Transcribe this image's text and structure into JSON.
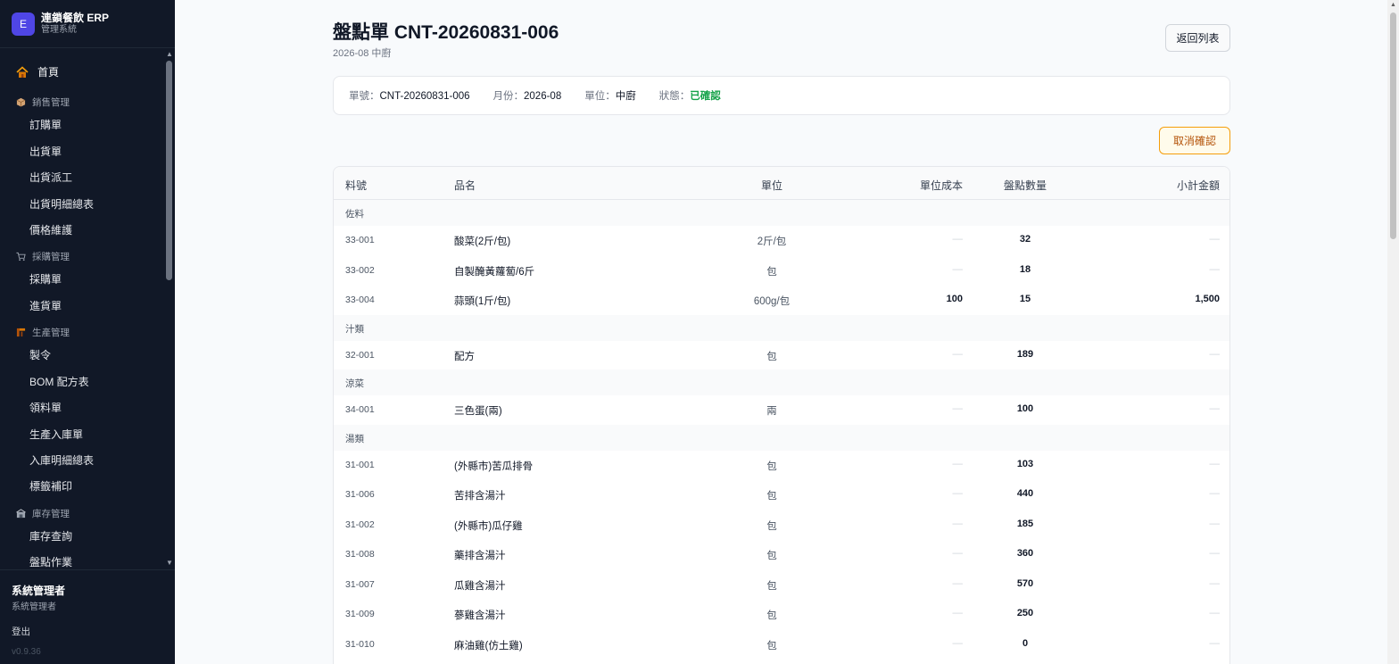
{
  "app": {
    "logo_letter": "E",
    "title": "連鎖餐飲 ERP",
    "subtitle": "管理系統"
  },
  "sidebar": {
    "home": "首頁",
    "sections": [
      {
        "label": "銷售管理",
        "icon": "box-icon",
        "items": [
          "訂購單",
          "出貨單",
          "出貨派工",
          "出貨明細總表",
          "價格維護"
        ]
      },
      {
        "label": "採購管理",
        "icon": "cart-icon",
        "items": [
          "採購單",
          "進貨單"
        ]
      },
      {
        "label": "生產管理",
        "icon": "tools-icon",
        "items": [
          "製令",
          "BOM 配方表",
          "領料單",
          "生產入庫單",
          "入庫明細總表",
          "標籤補印"
        ]
      },
      {
        "label": "庫存管理",
        "icon": "warehouse-icon",
        "items": [
          "庫存查詢",
          "盤點作業"
        ]
      }
    ]
  },
  "user": {
    "name": "系統管理者",
    "role": "系統管理者",
    "logout": "登出",
    "version": "v0.9.36"
  },
  "page": {
    "title": "盤點單 CNT-20260831-006",
    "subtitle": "2026-08 中廚",
    "back_button": "返回列表",
    "cancel_button": "取消確認"
  },
  "info": {
    "doc_no_label": "單號：",
    "doc_no": "CNT-20260831-006",
    "month_label": "月份：",
    "month": "2026-08",
    "unit_label": "單位：",
    "unit": "中廚",
    "status_label": "狀態：",
    "status": "已確認"
  },
  "colors": {
    "sidebar_bg": "#111827",
    "accent": "#4f46e5",
    "status_ok": "#16a34a",
    "warning": "#f59e0b"
  },
  "table": {
    "headers": {
      "code": "料號",
      "name": "品名",
      "unit": "單位",
      "cost": "單位成本",
      "qty": "盤點數量",
      "subtotal": "小計金額"
    },
    "groups": [
      {
        "name": "佐料",
        "rows": [
          {
            "code": "33-001",
            "name": "酸菜(2斤/包)",
            "unit": "2斤/包",
            "cost": "—",
            "qty": "32",
            "subtotal": "—"
          },
          {
            "code": "33-002",
            "name": "自製醃黃蘿蔔/6斤",
            "unit": "包",
            "cost": "—",
            "qty": "18",
            "subtotal": "—"
          },
          {
            "code": "33-004",
            "name": "蒜頭(1斤/包)",
            "unit": "600g/包",
            "cost": "100",
            "qty": "15",
            "subtotal": "1,500"
          }
        ]
      },
      {
        "name": "汁類",
        "rows": [
          {
            "code": "32-001",
            "name": "配方",
            "unit": "包",
            "cost": "—",
            "qty": "189",
            "subtotal": "—"
          }
        ]
      },
      {
        "name": "涼菜",
        "rows": [
          {
            "code": "34-001",
            "name": "三色蛋(兩)",
            "unit": "兩",
            "cost": "—",
            "qty": "100",
            "subtotal": "—"
          }
        ]
      },
      {
        "name": "湯類",
        "rows": [
          {
            "code": "31-001",
            "name": "(外縣市)苦瓜排骨",
            "unit": "包",
            "cost": "—",
            "qty": "103",
            "subtotal": "—"
          },
          {
            "code": "31-006",
            "name": "苦排含湯汁",
            "unit": "包",
            "cost": "—",
            "qty": "440",
            "subtotal": "—"
          },
          {
            "code": "31-002",
            "name": "(外縣市)瓜仔雞",
            "unit": "包",
            "cost": "—",
            "qty": "185",
            "subtotal": "—"
          },
          {
            "code": "31-008",
            "name": "藥排含湯汁",
            "unit": "包",
            "cost": "—",
            "qty": "360",
            "subtotal": "—"
          },
          {
            "code": "31-007",
            "name": "瓜雞含湯汁",
            "unit": "包",
            "cost": "—",
            "qty": "570",
            "subtotal": "—"
          },
          {
            "code": "31-009",
            "name": "蔘雞含湯汁",
            "unit": "包",
            "cost": "—",
            "qty": "250",
            "subtotal": "—"
          },
          {
            "code": "31-010",
            "name": "麻油雞(仿土雞)",
            "unit": "包",
            "cost": "—",
            "qty": "0",
            "subtotal": "—"
          }
        ]
      }
    ]
  }
}
